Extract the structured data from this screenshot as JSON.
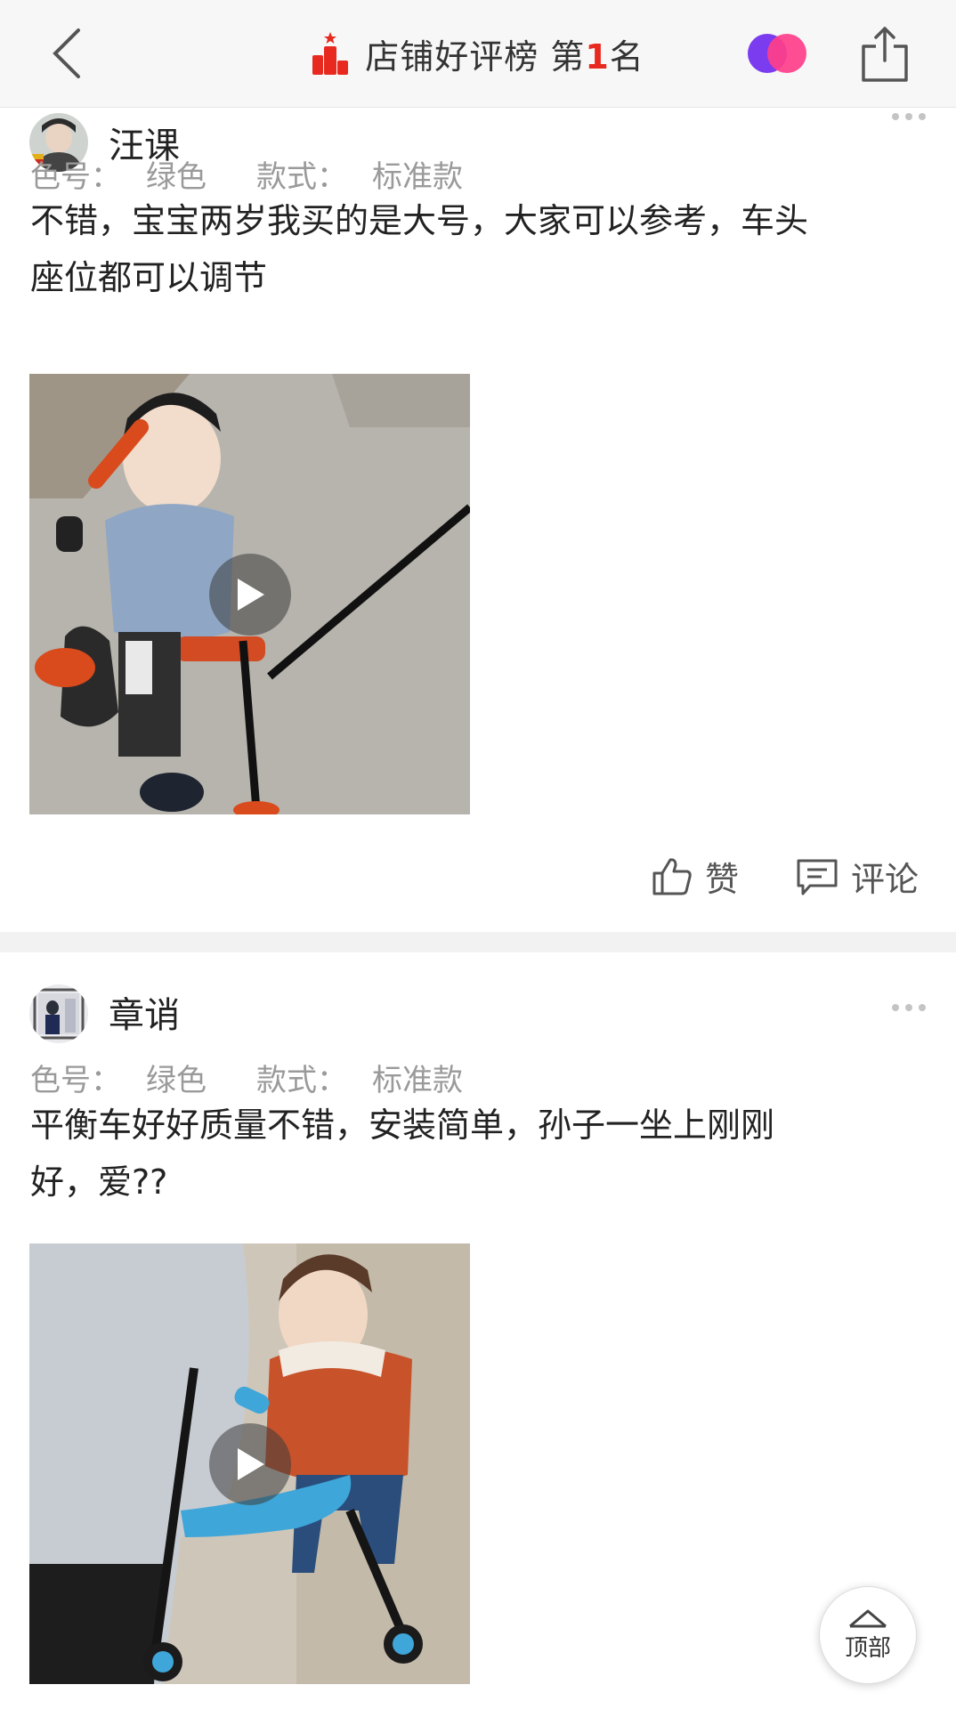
{
  "header": {
    "back_icon": "chevron-left-icon",
    "title_prefix": "店铺好评榜 第",
    "rank_number": "1",
    "title_suffix": "名",
    "rank_icon": "ranking-bars-icon",
    "rank_icon_color": "#e8291f",
    "mixed_icon": "overlapping-circles-icon",
    "share_icon": "share-icon"
  },
  "reviews": [
    {
      "username": "汪课",
      "spec_color_label": "色号：",
      "spec_color_value": "绿色",
      "spec_style_label": "款式：",
      "spec_style_value": "标准款",
      "content_line1": "不错，宝宝两岁我买的是大号，大家可以参考，车头",
      "content_line2": "座位都可以调节",
      "media": "video",
      "like_label": "赞",
      "comment_label": "评论"
    },
    {
      "username": "章诮",
      "spec_color_label": "色号：",
      "spec_color_value": "绿色",
      "spec_style_label": "款式：",
      "spec_style_value": "标准款",
      "content_line1": "平衡车好好质量不错，安装简单，孙子一坐上刚刚",
      "content_line2": "好，爱??",
      "media": "video"
    }
  ],
  "back_to_top": {
    "label": "顶部",
    "icon": "arrow-up-icon"
  },
  "colors": {
    "accent": "#e8291f",
    "muted_text": "#9a9a9a",
    "divider": "#f2f2f2"
  }
}
